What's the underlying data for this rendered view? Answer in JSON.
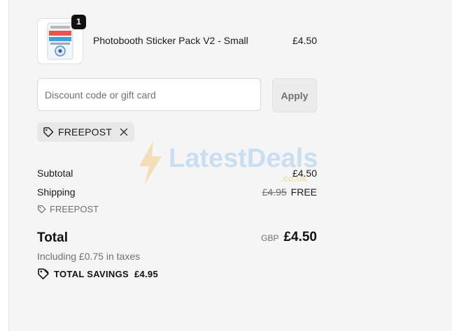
{
  "product": {
    "name": "Photobooth Sticker Pack V2 - Small",
    "price": "£4.50",
    "quantity": "1",
    "thumbnail_icon": "sticker-pack-image"
  },
  "discount": {
    "placeholder": "Discount code or gift card",
    "value": "",
    "apply_label": "Apply",
    "applied_code": "FREEPOST"
  },
  "summary": {
    "subtotal_label": "Subtotal",
    "subtotal_value": "£4.50",
    "shipping_label": "Shipping",
    "shipping_original": "£4.95",
    "shipping_value": "FREE",
    "shipping_code": "FREEPOST",
    "total_label": "Total",
    "currency": "GBP",
    "total_value": "£4.50",
    "taxes_note": "Including £0.75 in taxes",
    "savings_label": "TOTAL SAVINGS",
    "savings_value": "£4.95"
  },
  "watermark": {
    "text": "LatestDeals",
    "sub": ".co.uk"
  },
  "colors": {
    "page_bg": "#f5f5f5",
    "text": "#1a1a1a",
    "muted": "#707070",
    "chip_bg": "#e8e8e8",
    "watermark_blue": "#5aa7e8",
    "watermark_orange": "#f2a623"
  }
}
